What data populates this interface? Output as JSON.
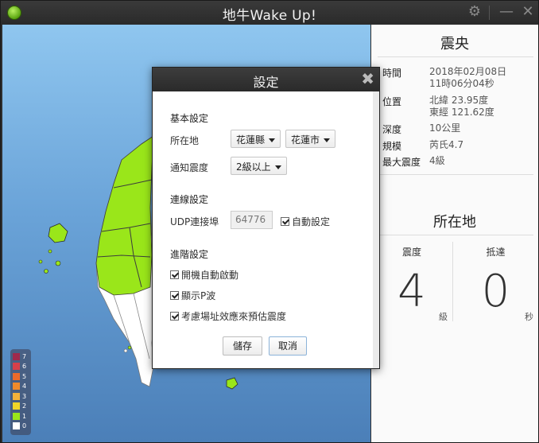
{
  "window": {
    "title": "地牛Wake Up!"
  },
  "epicenter": {
    "title": "震央",
    "rows": [
      {
        "label": "時間",
        "value": "2018年02月08日",
        "value2": "11時06分04秒"
      },
      {
        "label": "位置",
        "value": "北緯 23.95度",
        "value2": "東經 121.62度"
      },
      {
        "label": "深度",
        "value": "10公里"
      },
      {
        "label": "規模",
        "value": "芮氏4.7"
      },
      {
        "label": "最大震度",
        "value": "4級"
      }
    ]
  },
  "location": {
    "title": "所在地",
    "intensity_label": "震度",
    "intensity_value": "4",
    "intensity_unit": "級",
    "arrival_label": "抵達",
    "arrival_value": "0",
    "arrival_unit": "秒"
  },
  "scale": [
    {
      "level": "7",
      "color": "#a02a4c"
    },
    {
      "level": "6",
      "color": "#d6404a"
    },
    {
      "level": "5",
      "color": "#ea6a2a"
    },
    {
      "level": "4",
      "color": "#f08a2a"
    },
    {
      "level": "3",
      "color": "#f3b23a"
    },
    {
      "level": "2",
      "color": "#f0d528"
    },
    {
      "level": "1",
      "color": "#9ae61a"
    },
    {
      "level": "0",
      "color": "#ffffff"
    }
  ],
  "dialog": {
    "title": "設定",
    "basic": {
      "heading": "基本設定",
      "location_label": "所在地",
      "county": "花蓮縣",
      "city": "花蓮市",
      "notify_label": "通知震度",
      "notify_value": "2級以上"
    },
    "connection": {
      "heading": "連線設定",
      "port_label": "UDP連接埠",
      "port_value": "64776",
      "auto_label": "自動設定"
    },
    "advanced": {
      "heading": "進階設定",
      "opt1": "開機自動啟動",
      "opt2": "顯示P波",
      "opt3": "考慮場址效應來預估震度"
    },
    "save_label": "儲存",
    "cancel_label": "取消"
  }
}
